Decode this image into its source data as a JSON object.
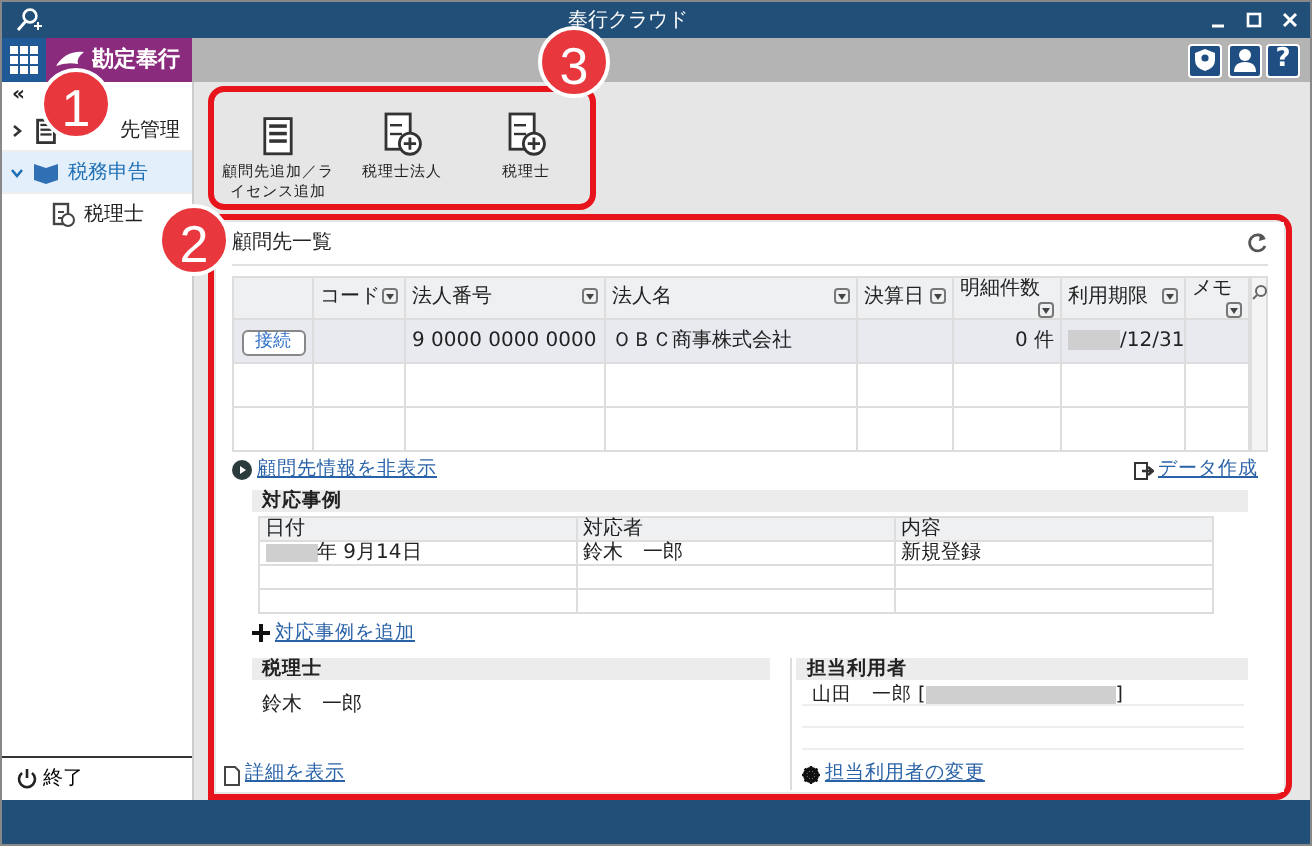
{
  "window": {
    "title": "奉行クラウド"
  },
  "header": {
    "logo": "勘定奉行",
    "help": "?"
  },
  "sidebar": {
    "collapse": "«",
    "items": [
      {
        "label": "先管理",
        "expanded": false,
        "selected": false
      },
      {
        "label": "税務申告",
        "expanded": true,
        "selected": true,
        "children": [
          {
            "label": "税理士",
            "selected": false
          }
        ]
      }
    ],
    "exit": "終了"
  },
  "toolbar": [
    {
      "label": "顧問先追加／ライセンス追加"
    },
    {
      "label": "税理士法人"
    },
    {
      "label": "税理士"
    }
  ],
  "panel": {
    "title": "顧問先一覧",
    "table": {
      "columns": [
        "コード",
        "法人番号",
        "法人名",
        "決算日",
        "明細件数",
        "利用期限",
        "メモ"
      ],
      "rows": [
        {
          "selected": true,
          "button": "接続",
          "cells": [
            null,
            {
              "text": "9 0000 0000 0000"
            },
            {
              "text": "ＯＢＣ商事株式会社"
            },
            null,
            {
              "text": "0 件"
            },
            {
              "text": "/12/31",
              "redacted": true
            },
            null
          ]
        },
        {
          "selected": false
        },
        {
          "selected": false
        }
      ]
    },
    "toggle_link": "顧問先情報を非表示",
    "export_link": "データ作成",
    "cases": {
      "title": "対応事例",
      "columns": [
        "日付",
        "対応者",
        "内容"
      ],
      "rows": [
        [
          {
            "text": "年 9月14日",
            "redacted": true
          },
          {
            "text": "鈴木　一郎"
          },
          {
            "text": "新規登録"
          }
        ],
        [],
        []
      ],
      "add_link": "対応事例を追加"
    },
    "accountant": {
      "title": "税理士",
      "name": "鈴木　一郎"
    },
    "users": {
      "title": "担当利用者",
      "rows": [
        {
          "text": "山田　一郎 [",
          "redacted": true,
          "suffix": "]"
        },
        {},
        {}
      ],
      "change_link": "担当利用者の変更"
    },
    "detail_link": "詳細を表示"
  },
  "callouts": [
    "1",
    "2",
    "3"
  ]
}
